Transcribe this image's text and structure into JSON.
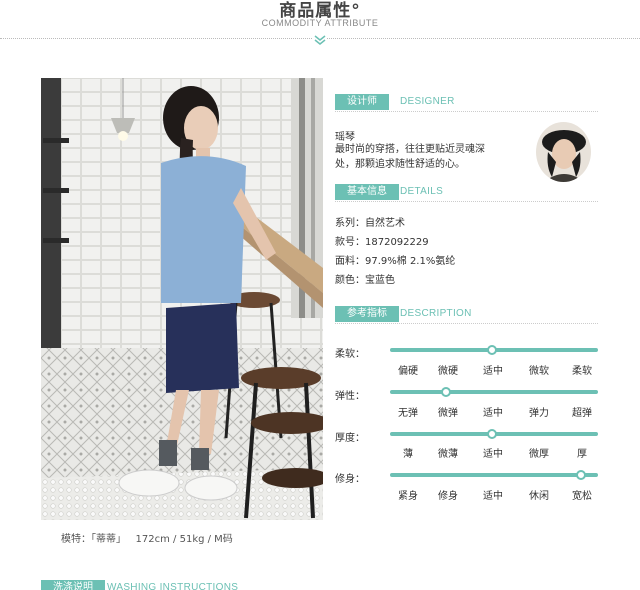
{
  "header": {
    "title": "商品属性°",
    "subtitle": "COMMODITY ATTRIBUTE"
  },
  "photo": {
    "caption": "模特：「蒂蒂」   172cm / 51kg / M码"
  },
  "designer": {
    "tag": "设计师",
    "tag_en": "DESIGNER",
    "name": "瑶琴",
    "desc_line1": "最时尚的穿搭，往往更贴近灵魂深",
    "desc_line2": "处，那颗追求随性舒适的心。"
  },
  "details": {
    "tag": "基本信息",
    "tag_en": "DETAILS",
    "rows": [
      {
        "text": "系列：自然艺术"
      },
      {
        "text": "款号：1872092229"
      },
      {
        "text": "面料：97.9%棉 2.1%氨纶"
      },
      {
        "text": "颜色：宝蓝色"
      }
    ]
  },
  "description": {
    "tag": "参考指标",
    "tag_en": "DESCRIPTION",
    "indicators": [
      {
        "label": "柔软：",
        "options": [
          "偏硬",
          "微硬",
          "适中",
          "微软",
          "柔软"
        ],
        "selected_position": 0.49
      },
      {
        "label": "弹性：",
        "options": [
          "无弹",
          "微弹",
          "适中",
          "弹力",
          "超弹"
        ],
        "selected_position": 0.27
      },
      {
        "label": "厚度：",
        "options": [
          "薄",
          "微薄",
          "适中",
          "微厚",
          "厚"
        ],
        "selected_position": 0.49
      },
      {
        "label": "修身：",
        "options": [
          "紧身",
          "修身",
          "适中",
          "休闲",
          "宽松"
        ],
        "selected_position": 0.92
      }
    ]
  },
  "washing": {
    "tag": "洗涤说明",
    "tag_en": "WASHING INSTRUCTIONS"
  },
  "colors": {
    "accent": "#6cc0b4"
  }
}
